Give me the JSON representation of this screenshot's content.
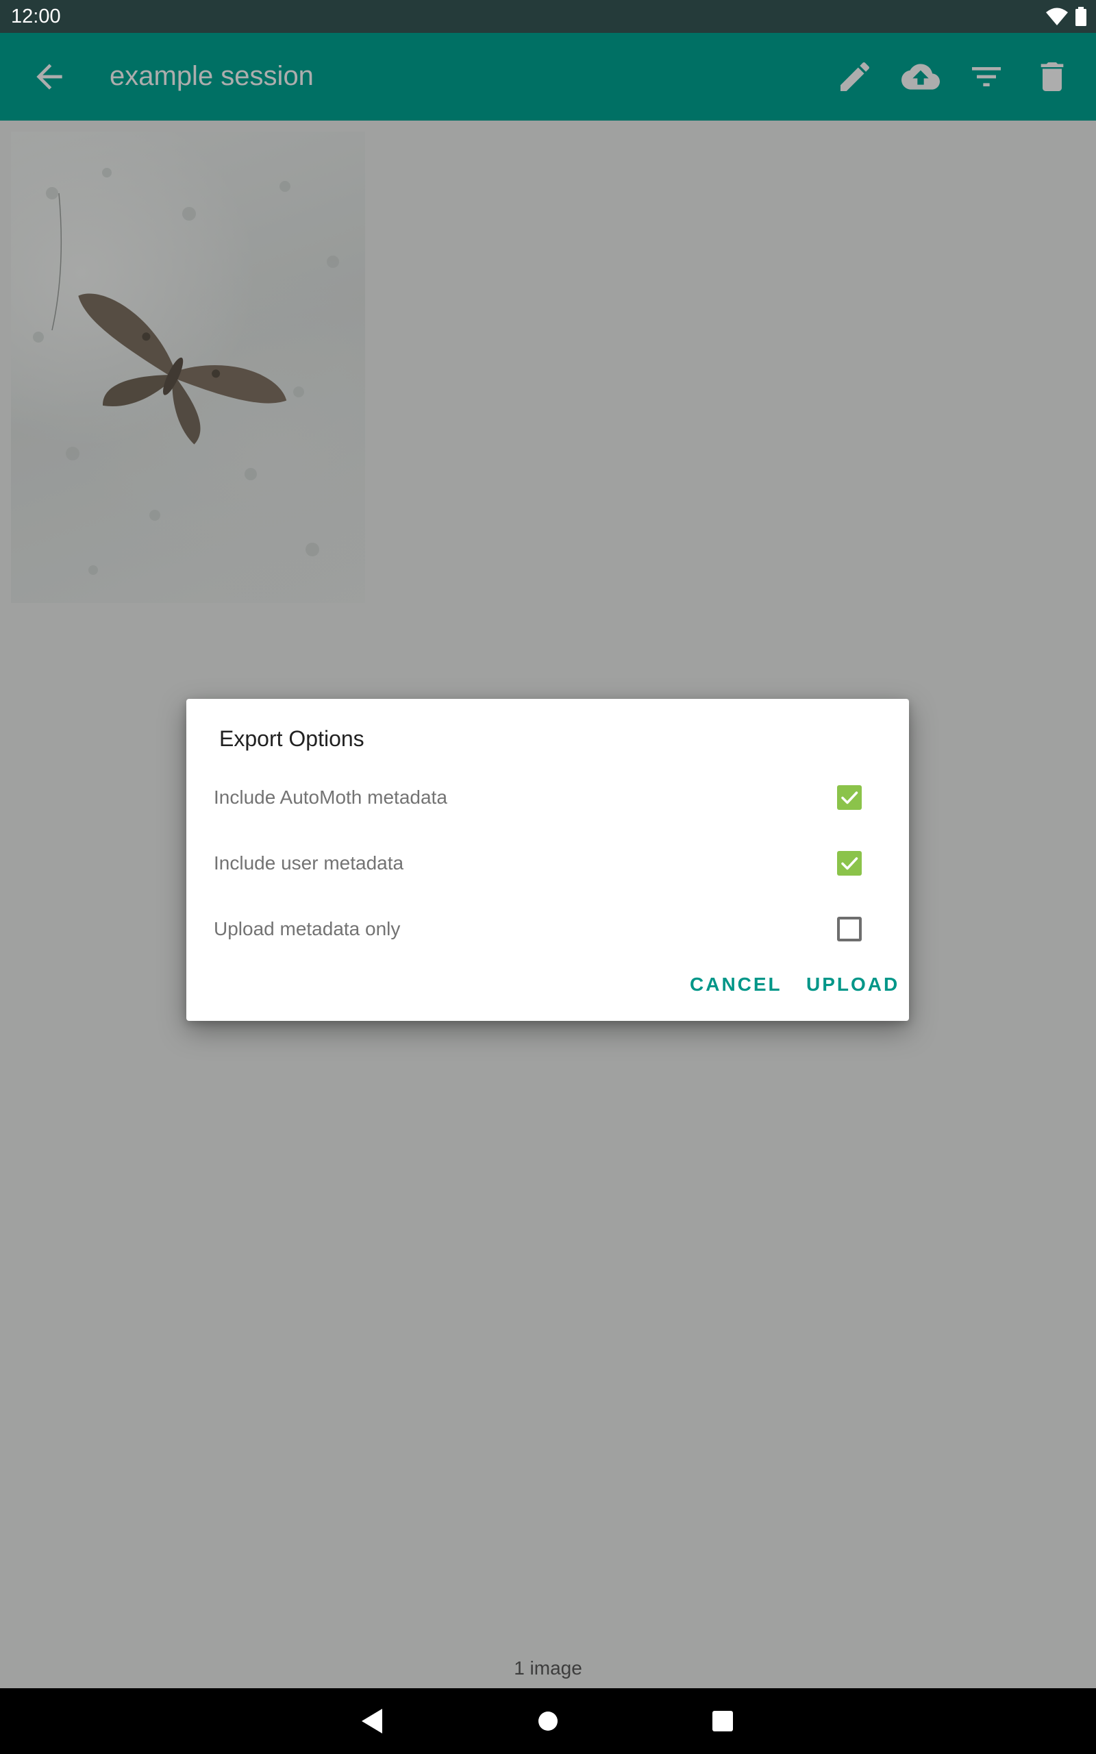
{
  "status_bar": {
    "time": "12:00",
    "icons": [
      "wifi-icon",
      "battery-icon"
    ]
  },
  "app_bar": {
    "title": "example session",
    "color": "#00a694",
    "actions": [
      "back-arrow-icon",
      "edit-pencil-icon",
      "cloud-upload-icon",
      "filter-icon",
      "delete-trash-icon"
    ]
  },
  "gallery": {
    "images": [
      {
        "subject": "moth"
      }
    ],
    "count_label": "1 image"
  },
  "dialog": {
    "title": "Export Options",
    "options": [
      {
        "label": "Include AutoMoth metadata",
        "checked": true
      },
      {
        "label": "Include user metadata",
        "checked": true
      },
      {
        "label": "Upload metadata only",
        "checked": false
      }
    ],
    "cancel_label": "CANCEL",
    "upload_label": "UPLOAD",
    "accent_color": "#009688",
    "checkbox_color": "#8bc34a"
  },
  "nav_bar": {
    "buttons": [
      "nav-back-icon",
      "nav-home-icon",
      "nav-recents-icon"
    ]
  }
}
